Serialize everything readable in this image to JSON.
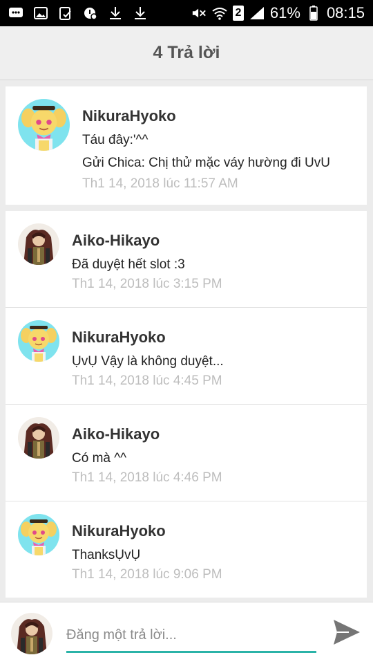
{
  "status_bar": {
    "icons": [
      "message-icon",
      "image-icon",
      "clipboard-icon",
      "alarm-icon",
      "download-icon",
      "download-icon",
      "mute-icon",
      "wifi-icon",
      "sim-icon",
      "signal-icon",
      "battery-icon"
    ],
    "sim_badge": "2",
    "battery": "61%",
    "time": "08:15"
  },
  "header": {
    "title": "4 Trả lời"
  },
  "post": {
    "author": "NikuraHyoko",
    "lines": [
      "Táu đây:'^^",
      "Gửi Chica: Chị thử mặc váy hường đi UvU"
    ],
    "time": "Th1 14, 2018 lúc 11:57 AM",
    "avatar": "chica-avatar"
  },
  "replies": [
    {
      "author": "Aiko-Hikayo",
      "text": "Đã duyệt hết slot :3",
      "time": "Th1 14, 2018 lúc 3:15 PM",
      "avatar": "aiko-avatar"
    },
    {
      "author": "NikuraHyoko",
      "text": "ỤvỤ Vậy là không duyệt...",
      "time": "Th1 14, 2018 lúc 4:45 PM",
      "avatar": "chica-avatar"
    },
    {
      "author": "Aiko-Hikayo",
      "text": "Có mà ^^",
      "time": "Th1 14, 2018 lúc 4:46 PM",
      "avatar": "aiko-avatar"
    },
    {
      "author": "NikuraHyoko",
      "text": "ThanksỤvỤ",
      "time": "Th1 14, 2018 lúc 9:06 PM",
      "avatar": "chica-avatar"
    }
  ],
  "composer": {
    "placeholder": "Đăng một trả lời...",
    "value": "",
    "send_icon": "send-icon",
    "avatar": "aiko-avatar"
  },
  "colors": {
    "accent": "#2bb3a8",
    "time_text": "#bdbdbd",
    "header_bg": "#efefef",
    "page_bg": "#ececec"
  }
}
